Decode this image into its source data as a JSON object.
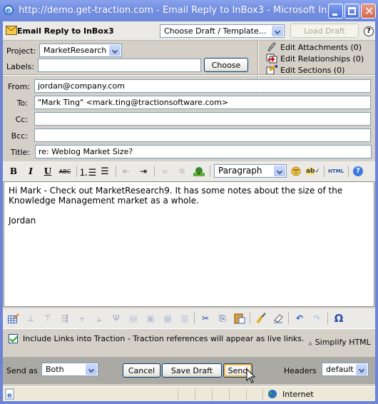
{
  "window": {
    "title": "http://demo.get-traction.com - Email Reply to InBox3 - Microsoft In...",
    "buttons": {
      "minimize": "minimize",
      "maximize": "maximize",
      "close": "close"
    }
  },
  "header": {
    "title": "Email Reply to InBox3",
    "draft_select": "Choose Draft / Template...",
    "load_draft_label": "Load Draft",
    "help_label": "?"
  },
  "meta": {
    "project_label": "Project:",
    "project_value": "MarketResearch",
    "labels_label": "Labels:",
    "labels_value": "",
    "choose_label": "Choose",
    "edit_links": [
      {
        "icon": "paperclip-icon",
        "label": "Edit Attachments (0)"
      },
      {
        "icon": "relationships-icon",
        "label": "Edit Relationships (0)"
      },
      {
        "icon": "sections-icon",
        "label": "Edit Sections (0)"
      }
    ]
  },
  "fields": {
    "from_label": "From:",
    "from_value": "jordan@company.com",
    "to_label": "To:",
    "to_value": "\"Mark Ting\" <mark.ting@tractionsoftware.com>",
    "cc_label": "Cc:",
    "cc_value": "",
    "bcc_label": "Bcc:",
    "bcc_value": "",
    "title_label": "Title:",
    "title_value": "re: Weblog Market Size?"
  },
  "toolbar": {
    "bold": "B",
    "italic": "I",
    "underline": "U",
    "strike": "ABC",
    "format_select": "Paragraph",
    "html_label": "HTML",
    "omega": "Ω"
  },
  "editor": {
    "line1": "Hi Mark - Check out MarketResearch9. It has some notes about the size of the Knowledge Management market as a whole.",
    "line2": "Jordan"
  },
  "footer": {
    "include_links_checked": true,
    "include_links_label": "Include Links into Traction - Traction references will appear as live links.",
    "simplify_label": "Simplify HTML"
  },
  "actions": {
    "send_as_label": "Send as",
    "send_as_value": "Both",
    "cancel_label": "Cancel",
    "save_draft_label": "Save Draft",
    "send_label": "Send",
    "headers_label": "Headers",
    "headers_value": "default"
  },
  "statusbar": {
    "zone": "Internet"
  }
}
